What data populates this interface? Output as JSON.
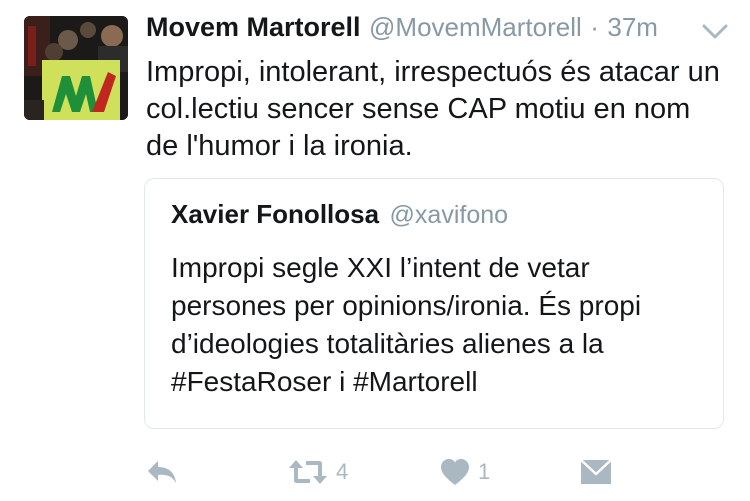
{
  "tweet": {
    "author_name": "Movem Martorell",
    "author_handle": "@MovemMartorell",
    "separator": "·",
    "time": "37m",
    "text": "Impropi, intolerant, irrespectuós és atacar un col.lectiu sencer sense CAP motiu en nom de l'humor i la ironia."
  },
  "quoted_tweet": {
    "author_name": "Xavier Fonollosa",
    "author_handle": "@xavifono",
    "text": "Impropi segle XXI l’intent de vetar persones per opinions/ironia. És propi d’ideologies totalitàries alienes a la #FestaRoser i #Martorell"
  },
  "actions": {
    "retweet_count": "4",
    "like_count": "1"
  },
  "colors": {
    "text": "#14171a",
    "secondary": "#8899a6",
    "icon": "#aab8c2",
    "border": "#e1e8ed"
  },
  "icons": [
    "chevron-down-icon",
    "reply-icon",
    "retweet-icon",
    "heart-icon",
    "direct-message-icon"
  ]
}
